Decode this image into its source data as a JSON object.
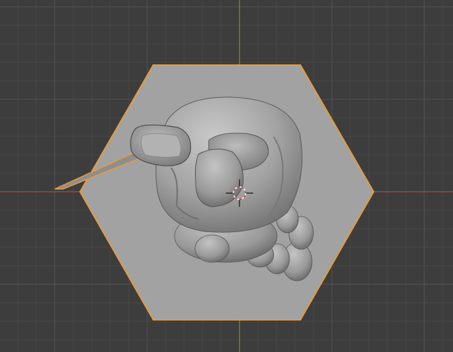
{
  "viewport": {
    "background_color": "#3d3d3d",
    "grid_minor_color": "#474747",
    "grid_major_color": "#525252",
    "x_axis_color": "#b4464c",
    "y_axis_color": "#6d9a2e",
    "selection_outline_color": "#e89b3a",
    "sculpt_surface_color": "#a4a4a4",
    "sculpt_shadow_color": "#5a5a5a",
    "sculpt_highlight_color": "#c8c8c8"
  },
  "scene": {
    "selected_object_icon": "hexagon-plane-object",
    "sculpt_object_icon": "sculpted-creature-mesh",
    "cursor_icon": "3d-cursor-icon"
  }
}
